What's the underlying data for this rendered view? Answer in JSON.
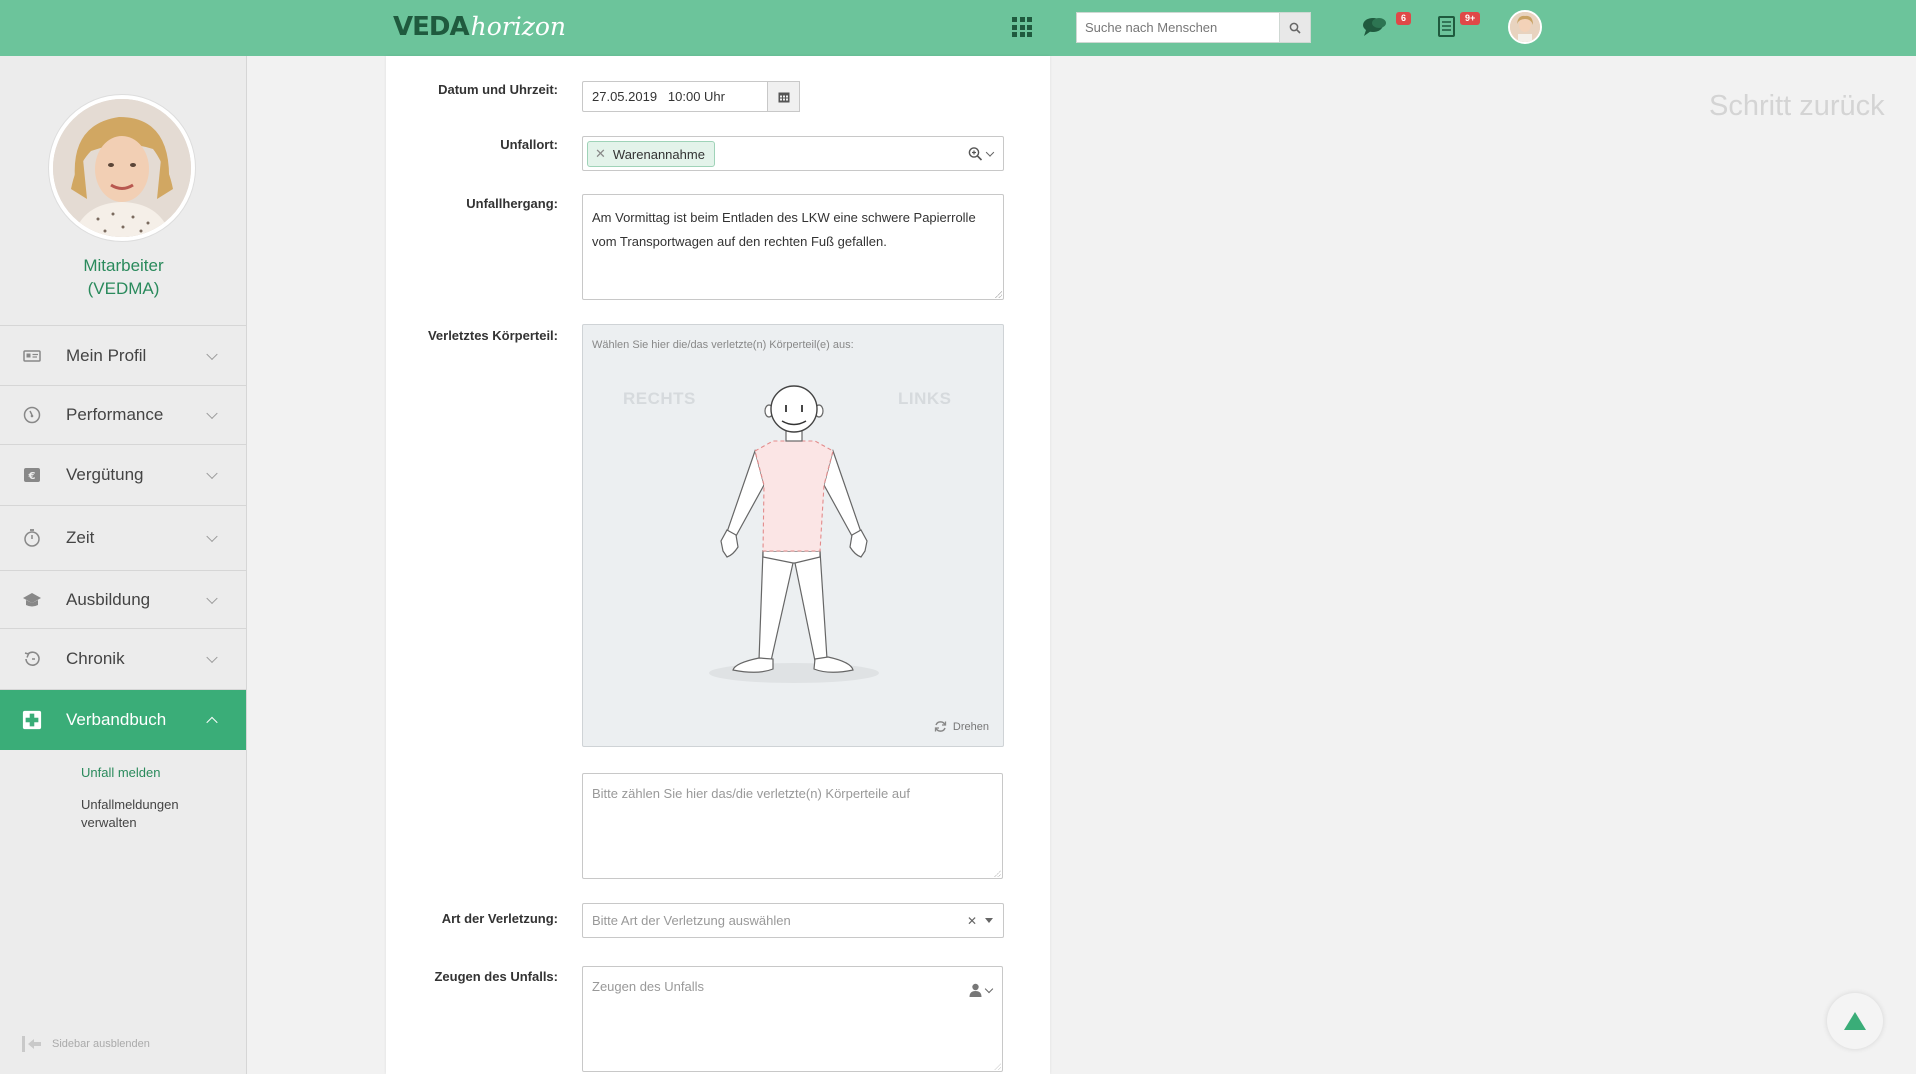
{
  "header": {
    "logo_veda": "VEDA",
    "logo_horizon": "horizon",
    "apps_icon": "grid-icon",
    "search_placeholder": "Suche nach Menschen",
    "chat_badge": "6",
    "tasks_badge": "9+",
    "accent_color": "#6cc49b"
  },
  "sidebar": {
    "profile_name_line1": "Mitarbeiter",
    "profile_name_line2": "(VEDMA)",
    "items": [
      {
        "label": "Mein Profil",
        "icon": "id-card-icon"
      },
      {
        "label": "Performance",
        "icon": "gauge-icon"
      },
      {
        "label": "Vergütung",
        "icon": "euro-icon"
      },
      {
        "label": "Zeit",
        "icon": "stopwatch-icon"
      },
      {
        "label": "Ausbildung",
        "icon": "graduation-cap-icon"
      },
      {
        "label": "Chronik",
        "icon": "history-icon"
      },
      {
        "label": "Verbandbuch",
        "icon": "first-aid-icon",
        "active": true
      }
    ],
    "subitems": [
      {
        "label": "Unfall melden",
        "current": true
      },
      {
        "label": "Unfallmeldungen verwalten"
      }
    ],
    "hide_label": "Sidebar ausblenden"
  },
  "form": {
    "datetime_label": "Datum und Uhrzeit:",
    "datetime_value": "27.05.2019   10:00 Uhr",
    "location_label": "Unfallort:",
    "location_tag": "Warenannahme",
    "description_label": "Unfallhergang:",
    "description_value": "Am Vormittag ist beim Entladen des LKW eine schwere Papierrolle vom Transportwagen auf den rechten Fuß gefallen.",
    "bodypart_label": "Verletztes Körperteil:",
    "bodypart_hint": "Wählen Sie hier die/das verletzte(n) Körperteil(e) aus:",
    "side_right": "RECHTS",
    "side_left": "LINKS",
    "rotate_label": "Drehen",
    "bodypart_text_placeholder": "Bitte zählen Sie hier das/die verletzte(n) Körperteile auf",
    "injury_type_label": "Art der Verletzung:",
    "injury_type_placeholder": "Bitte Art der Verletzung auswählen",
    "witness_label": "Zeugen des Unfalls:",
    "witness_placeholder": "Zeugen des Unfalls"
  },
  "step_back": "Schritt zurück"
}
